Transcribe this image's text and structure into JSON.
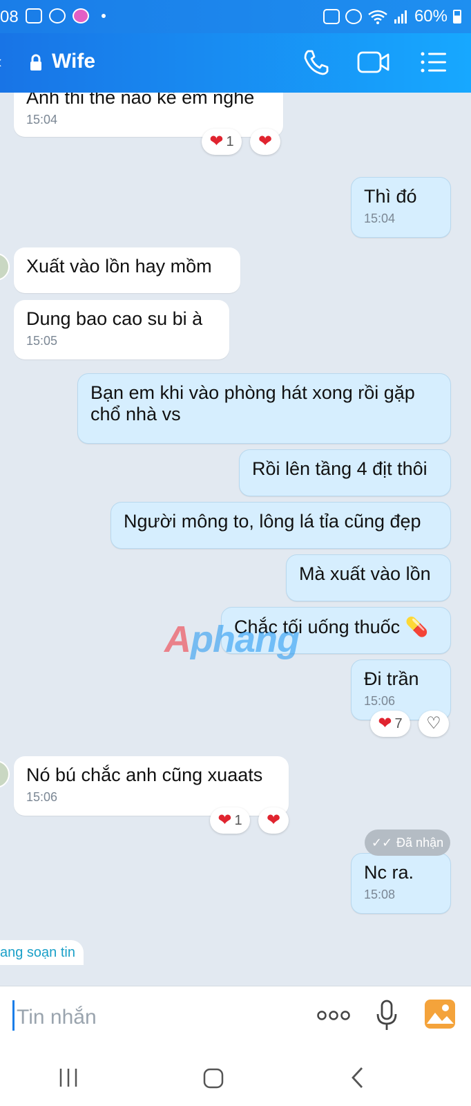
{
  "status": {
    "time": "08",
    "battery": "60%"
  },
  "header": {
    "title": "Wife",
    "icons": [
      "back-arrow-icon",
      "lock-icon",
      "phone-icon",
      "video-call-icon",
      "menu-list-icon"
    ]
  },
  "messages": [
    {
      "id": "m1",
      "side": "in",
      "text": "Anh thi thế nào kể em nghe",
      "time": "15:04",
      "reaction_count": "1"
    },
    {
      "id": "m2",
      "side": "out",
      "text": "Thì đó",
      "time": "15:04"
    },
    {
      "id": "m3",
      "side": "in",
      "text": "Xuất vào lồn hay mồm"
    },
    {
      "id": "m4",
      "side": "in",
      "text": "Dung bao cao su bi à",
      "time": "15:05"
    },
    {
      "id": "m5",
      "side": "out",
      "text": "Bạn em khi vào phòng hát xong rồi gặp chổ nhà vs"
    },
    {
      "id": "m6",
      "side": "out",
      "text": "Rồi lên tầng 4 địt thôi"
    },
    {
      "id": "m7",
      "side": "out",
      "text": "Người mông to, lông lá tỉa cũng đẹp"
    },
    {
      "id": "m8",
      "side": "out",
      "text": "Mà xuất vào lồn"
    },
    {
      "id": "m9",
      "side": "out",
      "text": "Chắc tối uống thuốc 💊"
    },
    {
      "id": "m10",
      "side": "out",
      "text": "Đi trần",
      "time": "15:06",
      "reaction_count": "7"
    },
    {
      "id": "m11",
      "side": "in",
      "text": "Nó bú chắc anh cũng xuaats",
      "time": "15:06",
      "reaction_count": "1"
    },
    {
      "id": "m12",
      "side": "out",
      "text": "Nc ra.",
      "time": "15:08"
    }
  ],
  "received_status": "Đã nhận",
  "typing_indicator": "ang soạn tin",
  "watermark": {
    "part1": "A",
    "part2": "phang"
  },
  "composer": {
    "placeholder": "Tin nhắn"
  },
  "colors": {
    "accent": "#1a7de8",
    "outgoing_bubble": "#d6eefe",
    "background": "#e2e9f1"
  }
}
